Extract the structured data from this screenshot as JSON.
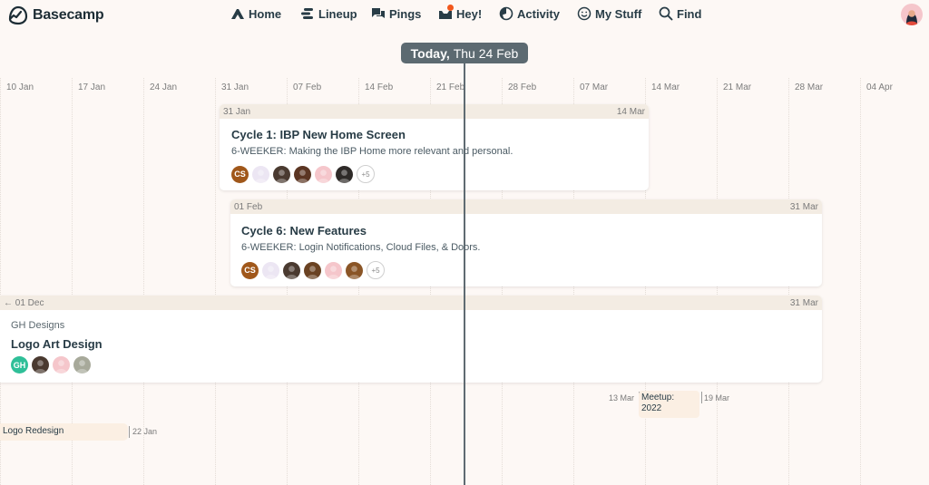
{
  "app": {
    "name": "Basecamp"
  },
  "nav": [
    {
      "label": "Home",
      "icon": "home-icon"
    },
    {
      "label": "Lineup",
      "icon": "lineup-icon"
    },
    {
      "label": "Pings",
      "icon": "pings-icon"
    },
    {
      "label": "Hey!",
      "icon": "hey-inbox-icon",
      "has_notification": true
    },
    {
      "label": "Activity",
      "icon": "activity-icon"
    },
    {
      "label": "My Stuff",
      "icon": "smiley-icon"
    },
    {
      "label": "Find",
      "icon": "search-icon"
    }
  ],
  "today": {
    "prefix": "Today,",
    "date": "Thu 24 Feb"
  },
  "weeks": [
    "10 Jan",
    "17 Jan",
    "24 Jan",
    "31 Jan",
    "07 Feb",
    "14 Feb",
    "21 Feb",
    "28 Feb",
    "07 Mar",
    "14 Mar",
    "21 Mar",
    "28 Mar",
    "04 Apr"
  ],
  "projects": [
    {
      "start": "31 Jan",
      "end": "14 Mar",
      "title": "Cycle 1: IBP New Home Screen",
      "description": "6-WEEKER: Making the IBP Home more relevant and personal.",
      "avatars": [
        {
          "initials": "CS",
          "color": "#a0571a"
        },
        {
          "initials": "",
          "color": "#ece6f3"
        },
        {
          "initials": "",
          "color": "#4a3a30"
        },
        {
          "initials": "",
          "color": "#5b3522"
        },
        {
          "initials": "",
          "color": "#f5c6cb"
        },
        {
          "initials": "",
          "color": "#2e2a28"
        }
      ],
      "more": "+5"
    },
    {
      "start": "01 Feb",
      "end": "31 Mar",
      "title": "Cycle 6: New Features",
      "description": "6-WEEKER: Login Notifications, Cloud Files, & Doors.",
      "avatars": [
        {
          "initials": "CS",
          "color": "#a0571a"
        },
        {
          "initials": "",
          "color": "#ece6f3"
        },
        {
          "initials": "",
          "color": "#4a3a30"
        },
        {
          "initials": "",
          "color": "#6a4222"
        },
        {
          "initials": "",
          "color": "#f5c6cb"
        },
        {
          "initials": "",
          "color": "#8a5526"
        }
      ],
      "more": "+5"
    },
    {
      "start": "← 01 Dec",
      "end": "31 Mar",
      "client": "GH Designs",
      "title": "Logo Art Design",
      "avatars": [
        {
          "initials": "GH",
          "color": "#2fbf98"
        },
        {
          "initials": "",
          "color": "#4a3a30"
        },
        {
          "initials": "",
          "color": "#f5c6cb"
        },
        {
          "initials": "",
          "color": "#a7a99a"
        }
      ]
    }
  ],
  "events": [
    {
      "title": "Meetup: 2022",
      "start": "13 Mar",
      "end": "19 Mar"
    },
    {
      "title": "Logo Redesign",
      "end": "22 Jan"
    }
  ],
  "colors": {
    "accent": "#5c6a71",
    "notification": "#f2571c",
    "range_bar": "#f3ece3",
    "event_bg": "#fbefe3"
  }
}
